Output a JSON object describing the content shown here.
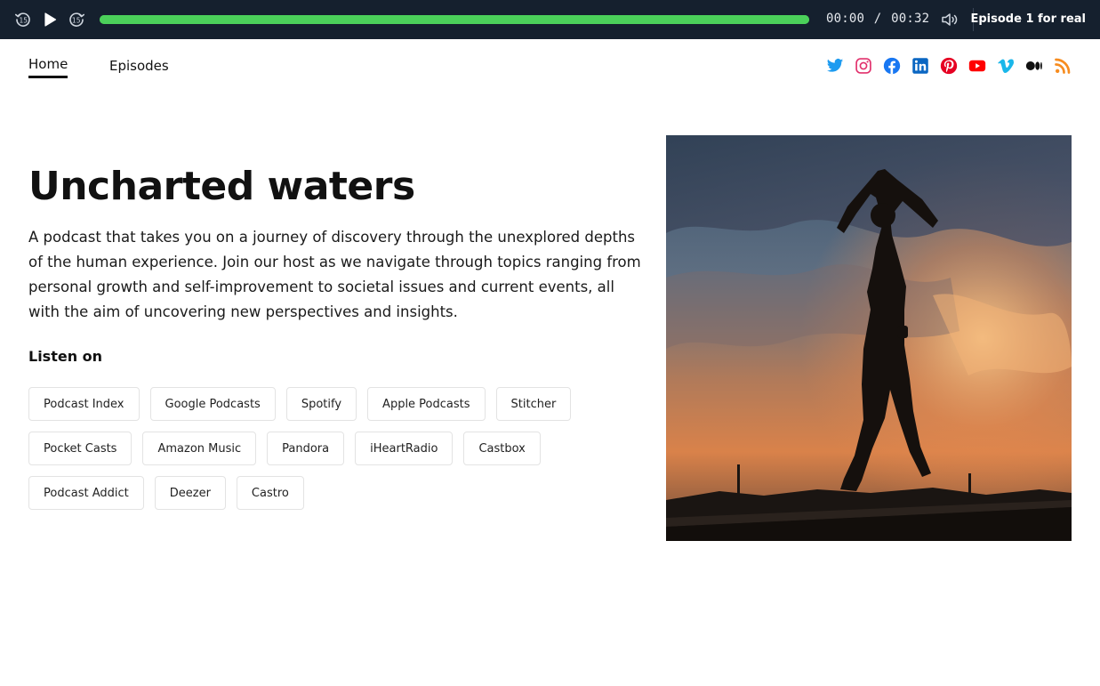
{
  "player": {
    "current_time": "00:00",
    "separator": "/",
    "duration": "00:32",
    "progress_fraction": 1.0,
    "episode_title": "Episode 1 for real",
    "accent_color": "#4bd05a",
    "icons": [
      "rewind-15-icon",
      "play-icon",
      "forward-15-icon",
      "volume-icon"
    ]
  },
  "nav": {
    "home": "Home",
    "episodes": "Episodes"
  },
  "socials": [
    "twitter-icon",
    "instagram-icon",
    "facebook-icon",
    "linkedin-icon",
    "pinterest-icon",
    "youtube-icon",
    "vimeo-icon",
    "medium-icon",
    "rss-icon"
  ],
  "hero": {
    "title": "Uncharted waters",
    "description": "A podcast that takes you on a journey of discovery through the unexplored depths of the human experience. Join our host as we navigate through topics ranging from personal growth and self-improvement to societal issues and current events, all with the aim of uncovering new perspectives and insights.",
    "listen_on": "Listen on"
  },
  "platforms": [
    [
      "Podcast Index",
      "Google Podcasts",
      "Spotify",
      "Apple Podcasts",
      "Stitcher"
    ],
    [
      "Pocket Casts",
      "Amazon Music",
      "Pandora",
      "iHeartRadio",
      "Castbox"
    ],
    [
      "Podcast Addict",
      "Deezer",
      "Castro"
    ]
  ]
}
